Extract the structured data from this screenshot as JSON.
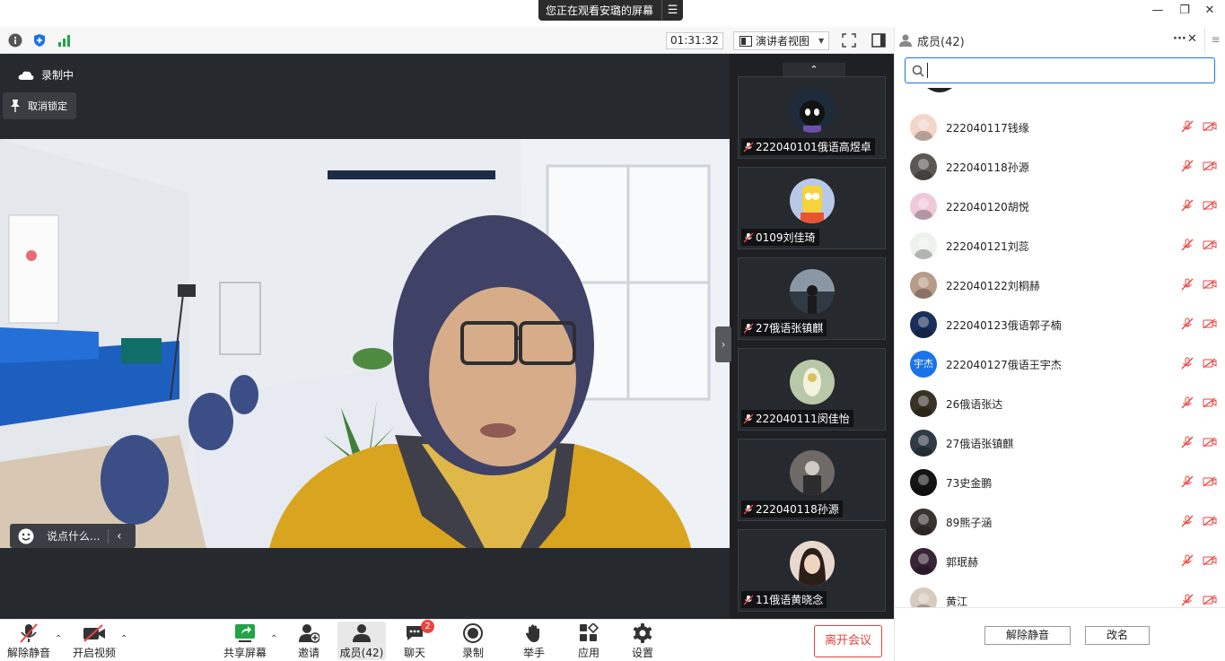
{
  "share_banner": {
    "text": "您正在观看安璐的屏幕",
    "menu_icon": "list-icon"
  },
  "window": {
    "minimize": "—",
    "maximize": "❐",
    "close": "✕"
  },
  "topbar": {
    "timer": "01:31:32",
    "view_label": "演讲者视图",
    "icons": [
      "info-icon",
      "shield-icon",
      "signal-icon",
      "fullscreen-icon",
      "panel-toggle-icon"
    ]
  },
  "main_video": {
    "recording_label": "录制中",
    "unlock_label": "取消锁定",
    "chat_placeholder": "说点什么..."
  },
  "thumbnails": [
    {
      "name": "222040101俄语高煜卓",
      "avatar_color": "#1d2b3a"
    },
    {
      "name": "0109刘佳琦",
      "avatar_color": "#b8c9e8"
    },
    {
      "name": "27俄语张镇麒",
      "avatar_color": "#2f3a44"
    },
    {
      "name": "222040111闵佳怡",
      "avatar_color": "#b9c8a8"
    },
    {
      "name": "222040118孙源",
      "avatar_color": "#6e6a67"
    },
    {
      "name": "11俄语黄晓念",
      "avatar_color": "#e8d9cf"
    }
  ],
  "panel": {
    "title": "成员(42)",
    "more_label": "···",
    "close_label": "✕",
    "search_value": "",
    "members": [
      {
        "name": "222040117钱缘",
        "avatar_color": "#f2d6c9"
      },
      {
        "name": "222040118孙源",
        "avatar_color": "#5d5753"
      },
      {
        "name": "222040120胡悦",
        "avatar_color": "#f0c8d8"
      },
      {
        "name": "222040121刘蕊",
        "avatar_color": "#eef2ee"
      },
      {
        "name": "222040122刘桐赫",
        "avatar_color": "#b89a88"
      },
      {
        "name": "222040123俄语郭子楠",
        "avatar_color": "#1a2f5a"
      },
      {
        "name": "222040127俄语王宇杰",
        "avatar_color": "#1a73e8",
        "avatar_text": "宇杰"
      },
      {
        "name": "26俄语张达",
        "avatar_color": "#3a3226"
      },
      {
        "name": "27俄语张镇麒",
        "avatar_color": "#2f3a44"
      },
      {
        "name": "73史金鹏",
        "avatar_color": "#141414"
      },
      {
        "name": "89熊子涵",
        "avatar_color": "#3a3330"
      },
      {
        "name": "郭珉赫",
        "avatar_color": "#3a2438"
      },
      {
        "name": "黄江",
        "avatar_color": "#d8cbbd"
      }
    ],
    "unmute_all_label": "解除静音",
    "rename_label": "改名"
  },
  "bottombar": {
    "unmute_label": "解除静音",
    "video_label": "开启视频",
    "share_label": "共享屏幕",
    "invite_label": "邀请",
    "members_label": "成员(42)",
    "chat_label": "聊天",
    "chat_badge": "2",
    "record_label": "录制",
    "raise_hand_label": "举手",
    "apps_label": "应用",
    "settings_label": "设置",
    "leave_label": "离开会议"
  },
  "colors": {
    "accent": "#1a73e8",
    "danger": "#e0443e",
    "share_green": "#22a447"
  }
}
